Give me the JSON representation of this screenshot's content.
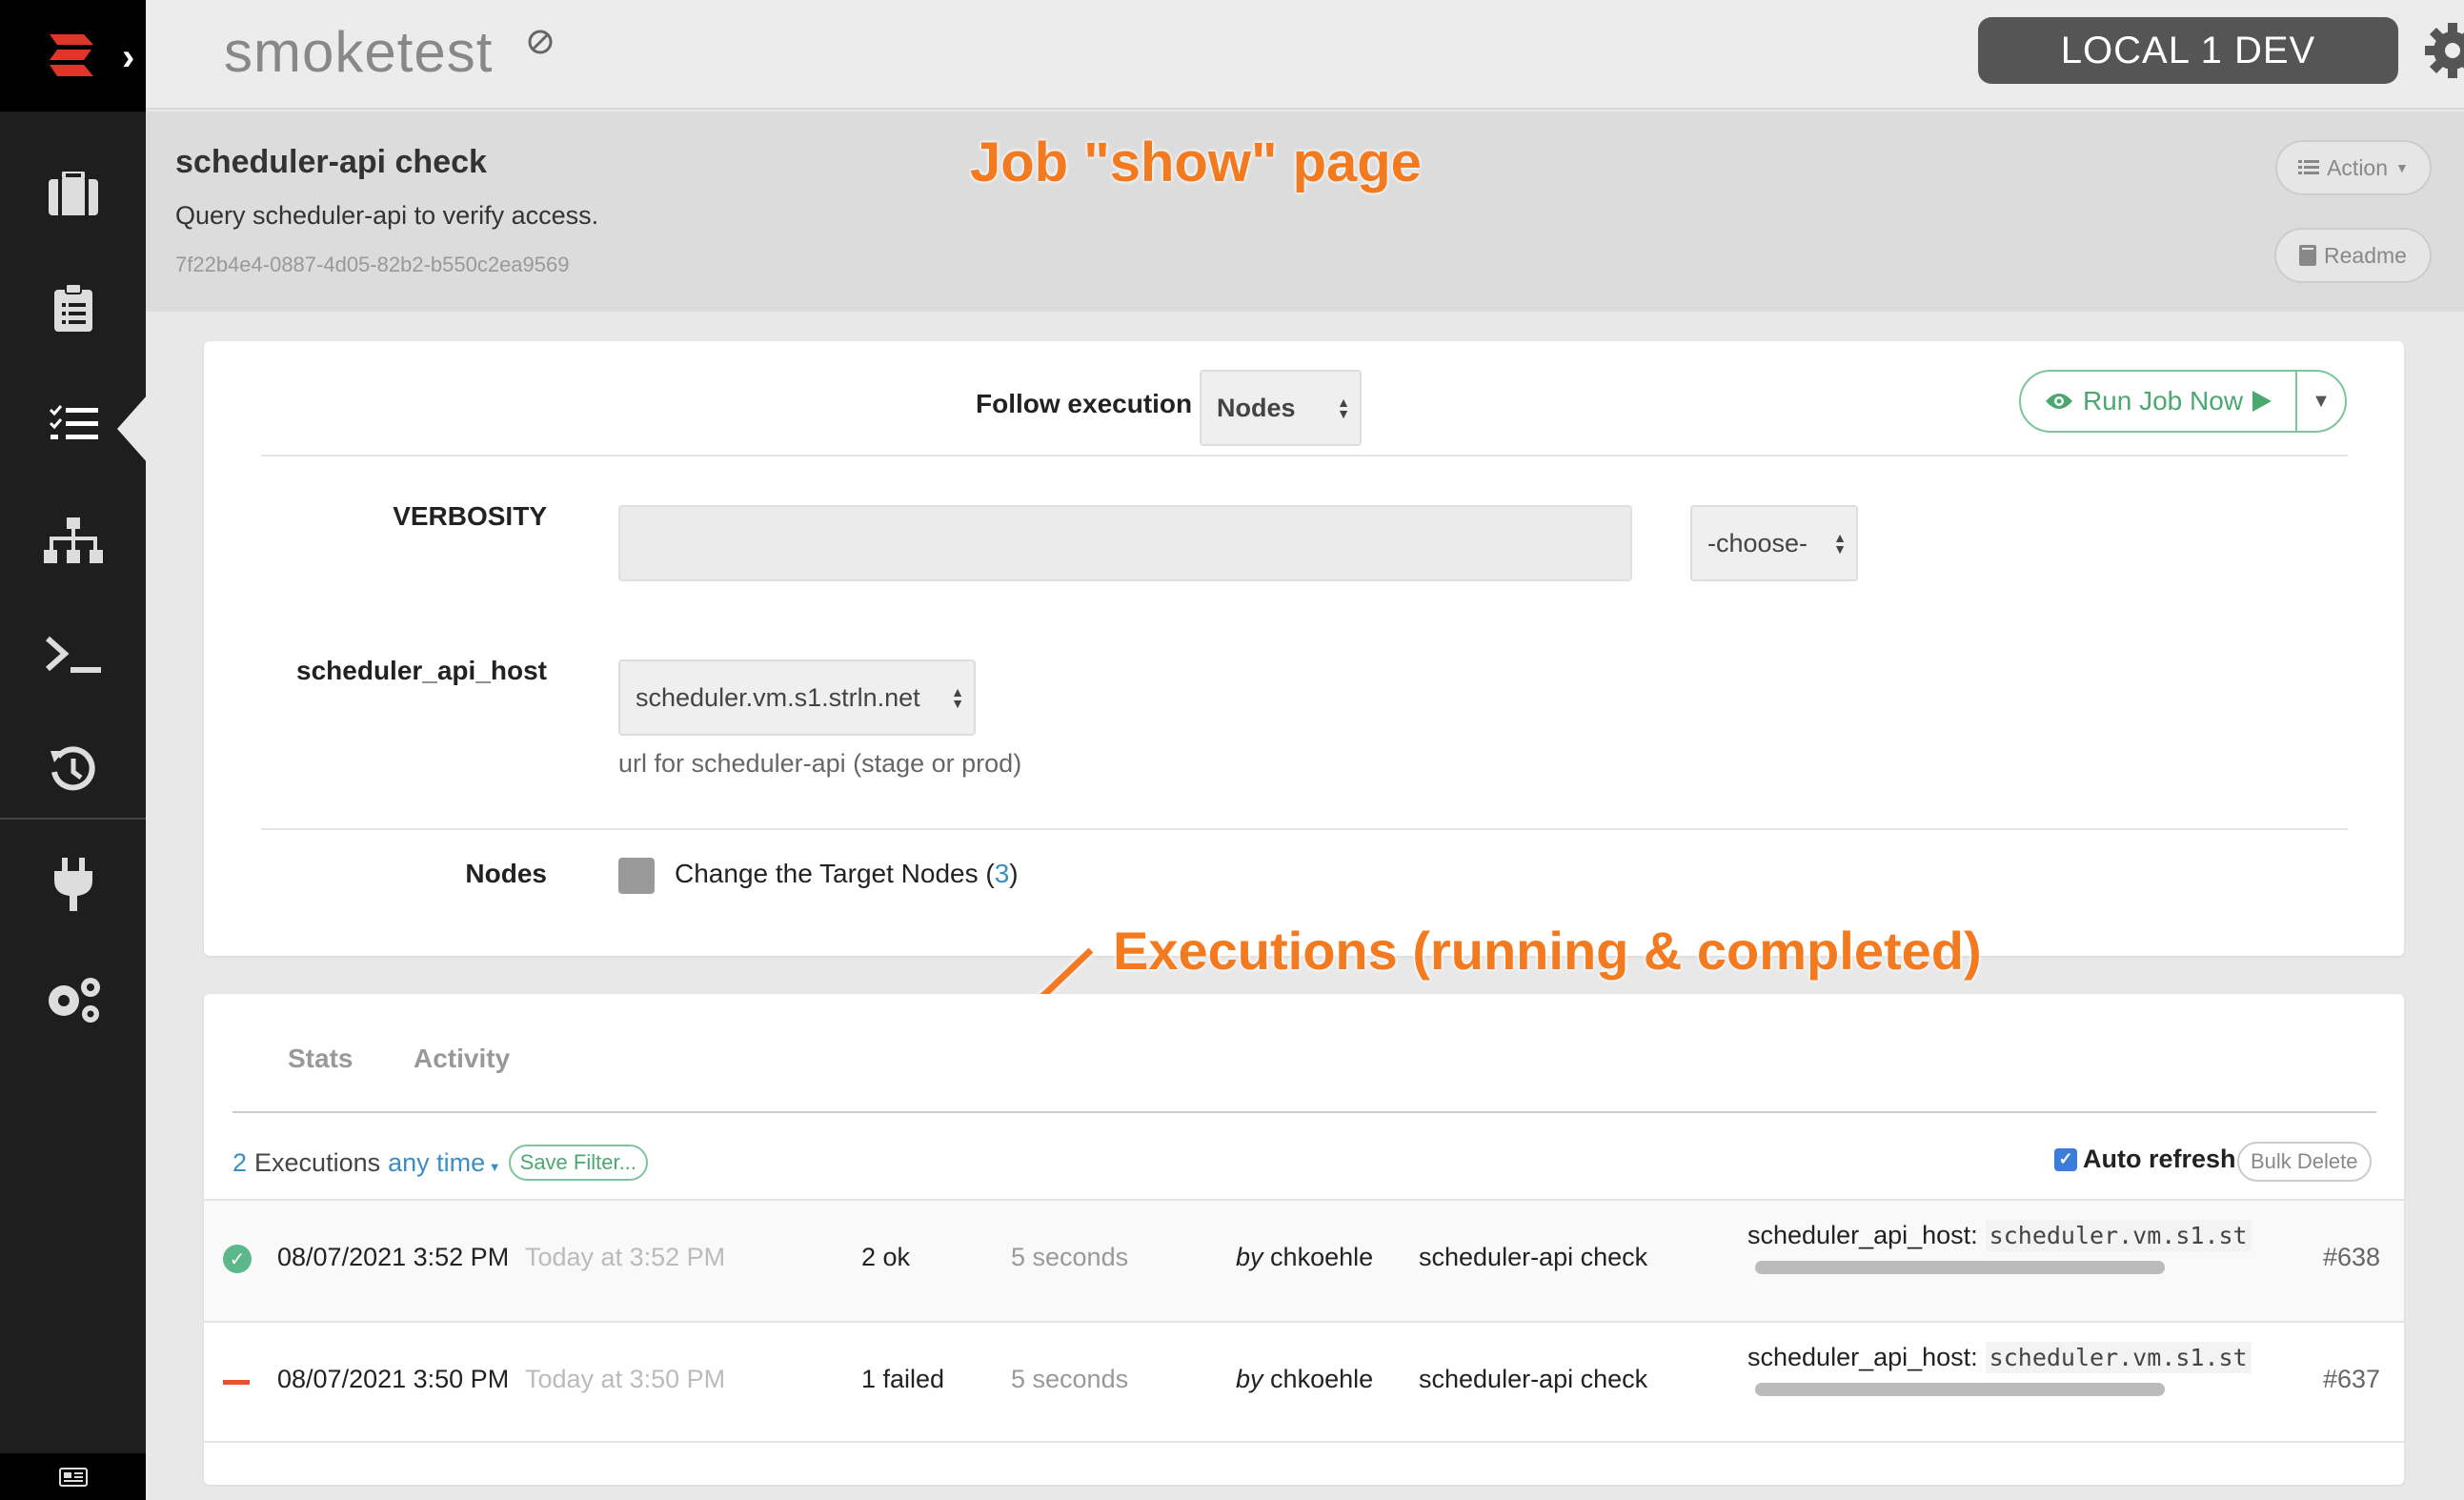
{
  "project": {
    "name": "smoketest",
    "badge_icon": "circle-slash-icon"
  },
  "environment": {
    "label": "LOCAL 1 DEV"
  },
  "job": {
    "title": "scheduler-api check",
    "description": "Query scheduler-api to verify access.",
    "uuid": "7f22b4e4-0887-4d05-82b2-b550c2ea9569",
    "action_label": "Action",
    "readme_label": "Readme"
  },
  "annotations": {
    "job_show": "Job \"show\" page",
    "executions": "Executions (running & completed)"
  },
  "run_form": {
    "follow_label": "Follow execution",
    "follow_value": "Nodes",
    "run_label": "Run Job Now",
    "verbosity_label": "VERBOSITY",
    "verbosity_value": "",
    "verbosity_choose": "-choose-",
    "host_label": "scheduler_api_host",
    "host_value": "scheduler.vm.s1.strln.net",
    "host_help": "url for scheduler-api (stage or prod)",
    "nodes_label": "Nodes",
    "change_target_text": "Change the Target Nodes (",
    "change_target_count": "3",
    "change_target_close": ")"
  },
  "executions": {
    "tabs": [
      "Stats",
      "Activity"
    ],
    "count": "2",
    "count_label": "Executions",
    "time_filter": "any time",
    "save_filter": "Save Filter...",
    "auto_refresh": "Auto refresh",
    "bulk_delete": "Bulk Delete",
    "rows": [
      {
        "status": "ok",
        "datetime": "08/07/2021 3:52 PM",
        "relative": "Today at 3:52 PM",
        "result": "2 ok",
        "duration": "5 seconds",
        "by": "by",
        "user": "chkoehle",
        "job": "scheduler-api check",
        "opt_key": "scheduler_api_host:",
        "opt_val": "scheduler.vm.s1.st",
        "id": "#638"
      },
      {
        "status": "failed",
        "datetime": "08/07/2021 3:50 PM",
        "relative": "Today at 3:50 PM",
        "result": "1 failed",
        "duration": "5 seconds",
        "by": "by",
        "user": "chkoehle",
        "job": "scheduler-api check",
        "opt_key": "scheduler_api_host:",
        "opt_val": "scheduler.vm.s1.st",
        "id": "#637"
      }
    ]
  },
  "colors": {
    "accent_green": "#4aa870",
    "annotation_orange": "#f47a20",
    "link_blue": "#3b8ec4",
    "fail_red": "#e8532f"
  }
}
